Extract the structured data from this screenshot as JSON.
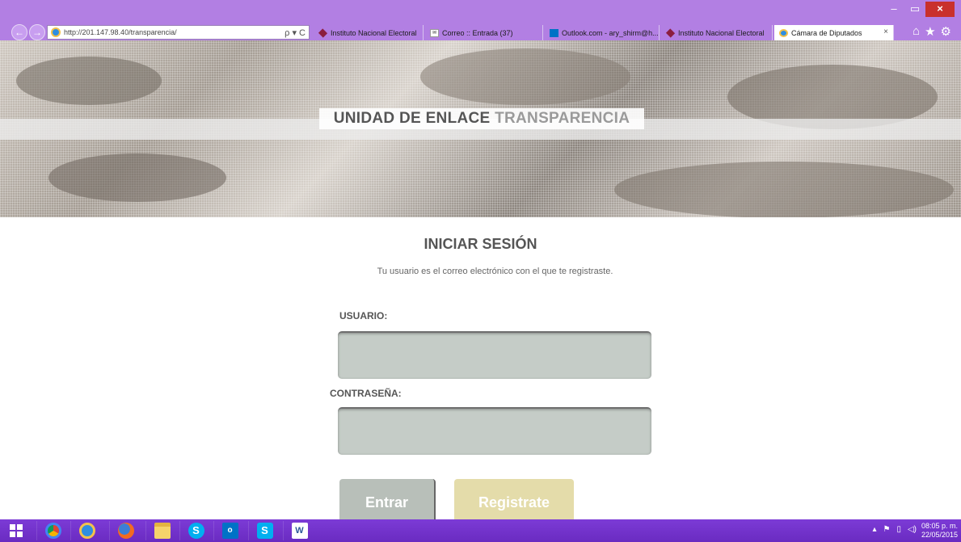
{
  "browser": {
    "url": "http://201.147.98.40/transparencia/",
    "address_tools": "ρ ▾ C",
    "tabs": [
      {
        "label": "Instituto Nacional Electoral",
        "icon": "ine-icon"
      },
      {
        "label": "Correo :: Entrada (37)",
        "icon": "mail-icon"
      },
      {
        "label": "Outlook.com - ary_shirm@h...",
        "icon": "outlook-icon"
      },
      {
        "label": "Instituto Nacional Electoral",
        "icon": "ine-icon"
      },
      {
        "label": "Cámara de Diputados",
        "icon": "ie-icon",
        "active": true
      }
    ],
    "tab_close": "×",
    "window_buttons": {
      "minimize": "–",
      "restore": "▭",
      "close": "×"
    },
    "toolbar_icons": {
      "home": "⌂",
      "favorites": "★",
      "settings": "⚙"
    },
    "back": "←",
    "forward": "→",
    "chrome_color": "#b27fe3"
  },
  "banner": {
    "title_strong": "UNIDAD DE ENLACE",
    "title_light": "TRANSPARENCIA"
  },
  "login": {
    "title": "INICIAR SESIÓN",
    "subtitle": "Tu usuario es el correo electrónico con el que te registraste.",
    "usuario_label": "USUARIO:",
    "usuario_value": "",
    "password_label": "CONTRASEÑA:",
    "password_value": "",
    "submit_label": "Entrar",
    "register_label": "Registrate",
    "submit_color": "#b8bfb9",
    "register_color": "#e4dcaa"
  },
  "taskbar": {
    "apps": [
      "start-icon",
      "chrome-icon",
      "ie-icon",
      "firefox-icon",
      "file-explorer-icon",
      "skype-alert-icon",
      "outlook-icon",
      "skype-icon",
      "word-icon"
    ],
    "clock_time": "08:05 p. m.",
    "clock_date": "22/05/2015",
    "taskbar_color": "#6a2bc1"
  }
}
